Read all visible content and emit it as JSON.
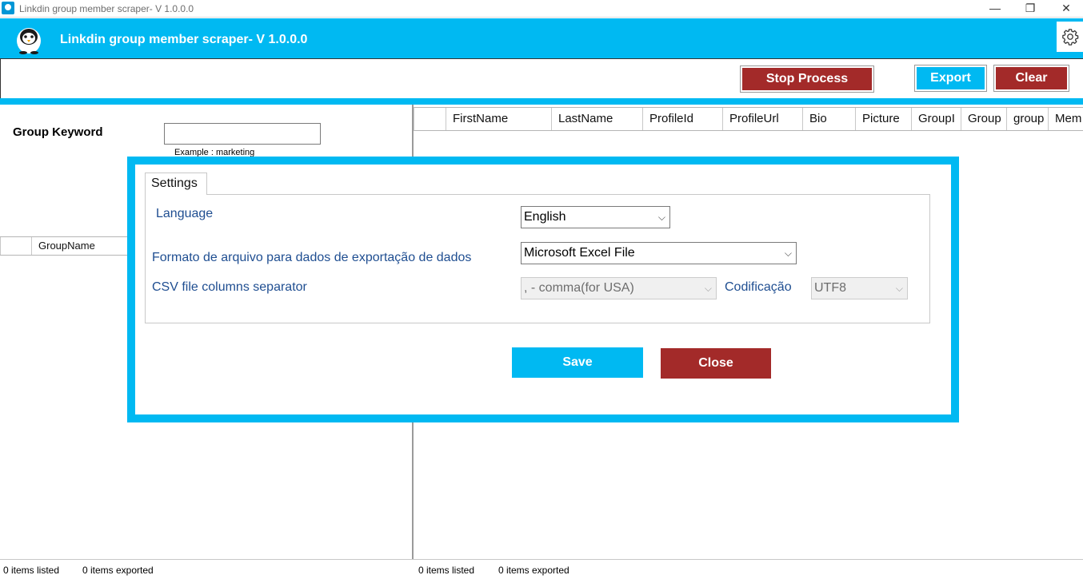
{
  "window": {
    "title": "Linkdin group member scraper- V 1.0.0.0",
    "minimize": "—",
    "restore": "❐",
    "close": "✕"
  },
  "header": {
    "app_title": "Linkdin group member scraper- V 1.0.0.0"
  },
  "toolbar": {
    "stop_label": "Stop Process",
    "export_label": "Export",
    "clear_label": "Clear"
  },
  "left": {
    "keyword_label": "Group Keyword",
    "keyword_value": "",
    "example": "Example : marketing",
    "columns": [
      "",
      "GroupName"
    ]
  },
  "right": {
    "columns": [
      "",
      "FirstName",
      "LastName",
      "ProfileId",
      "ProfileUrl",
      "Bio",
      "Picture",
      "GroupI",
      "Group",
      "group",
      "Mem"
    ]
  },
  "status": {
    "left_listed": "0 items listed",
    "left_exported": "0 items exported",
    "right_listed": "0 items listed",
    "right_exported": "0 items exported"
  },
  "settings": {
    "tab_label": "Settings",
    "language_label": "Language",
    "language_value": "English",
    "format_label": "Formato de arquivo para dados de exportação de dados",
    "format_value": "Microsoft Excel File",
    "separator_label": "CSV file columns separator",
    "separator_value": ", - comma(for USA)",
    "encoding_label": "Codificação",
    "encoding_value": "UTF8",
    "save_label": "Save",
    "close_label": "Close"
  },
  "colors": {
    "accent": "#00b9f2",
    "danger": "#a32a29",
    "label_text": "#1f4e91"
  }
}
